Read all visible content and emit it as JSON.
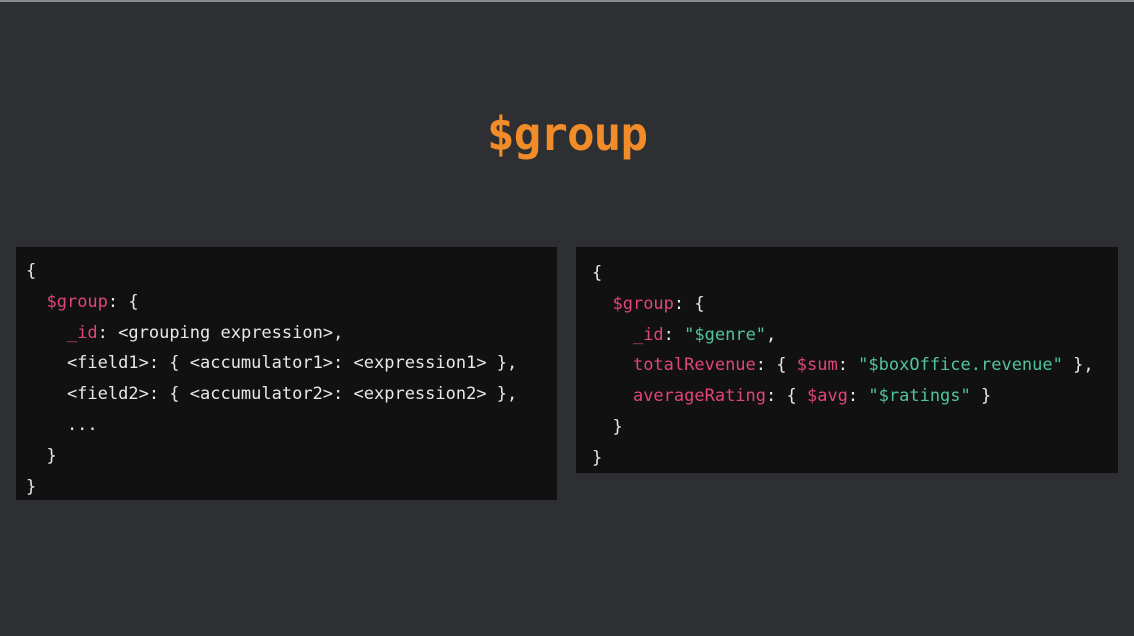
{
  "slide": {
    "title": "$group"
  },
  "left_code": {
    "lines": [
      [
        {
          "t": "{",
          "c": "p"
        }
      ],
      [
        {
          "t": "  ",
          "c": "p"
        },
        {
          "t": "$group",
          "c": "k"
        },
        {
          "t": ": {",
          "c": "p"
        }
      ],
      [
        {
          "t": "    ",
          "c": "p"
        },
        {
          "t": "_id",
          "c": "k"
        },
        {
          "t": ": <grouping expression>,",
          "c": "p"
        }
      ],
      [
        {
          "t": "    <field1>: { <accumulator1>: <expression1> },",
          "c": "p"
        }
      ],
      [
        {
          "t": "    <field2>: { <accumulator2>: <expression2> },",
          "c": "p"
        }
      ],
      [
        {
          "t": "    ...",
          "c": "p"
        }
      ],
      [
        {
          "t": "  }",
          "c": "p"
        }
      ],
      [
        {
          "t": "}",
          "c": "p"
        }
      ]
    ]
  },
  "right_code": {
    "lines": [
      [
        {
          "t": "{",
          "c": "p"
        }
      ],
      [
        {
          "t": "  ",
          "c": "p"
        },
        {
          "t": "$group",
          "c": "k"
        },
        {
          "t": ": {",
          "c": "p"
        }
      ],
      [
        {
          "t": "    ",
          "c": "p"
        },
        {
          "t": "_id",
          "c": "k"
        },
        {
          "t": ": ",
          "c": "p"
        },
        {
          "t": "\"$genre\"",
          "c": "s"
        },
        {
          "t": ",",
          "c": "p"
        }
      ],
      [
        {
          "t": "    ",
          "c": "p"
        },
        {
          "t": "totalRevenue",
          "c": "k"
        },
        {
          "t": ": { ",
          "c": "p"
        },
        {
          "t": "$sum",
          "c": "k"
        },
        {
          "t": ": ",
          "c": "p"
        },
        {
          "t": "\"$boxOffice.revenue\"",
          "c": "s"
        },
        {
          "t": " },",
          "c": "p"
        }
      ],
      [
        {
          "t": "    ",
          "c": "p"
        },
        {
          "t": "averageRating",
          "c": "k"
        },
        {
          "t": ": { ",
          "c": "p"
        },
        {
          "t": "$avg",
          "c": "k"
        },
        {
          "t": ": ",
          "c": "p"
        },
        {
          "t": "\"$ratings\"",
          "c": "s"
        },
        {
          "t": " }",
          "c": "p"
        }
      ],
      [
        {
          "t": "  }",
          "c": "p"
        }
      ],
      [
        {
          "t": "}",
          "c": "p"
        }
      ]
    ]
  },
  "colors": {
    "background": "#2e2f33",
    "title": "#f28c28",
    "code_background": "#111111",
    "keyword": "#e0457b",
    "string": "#52c49a",
    "plain": "#e8e8e8"
  }
}
